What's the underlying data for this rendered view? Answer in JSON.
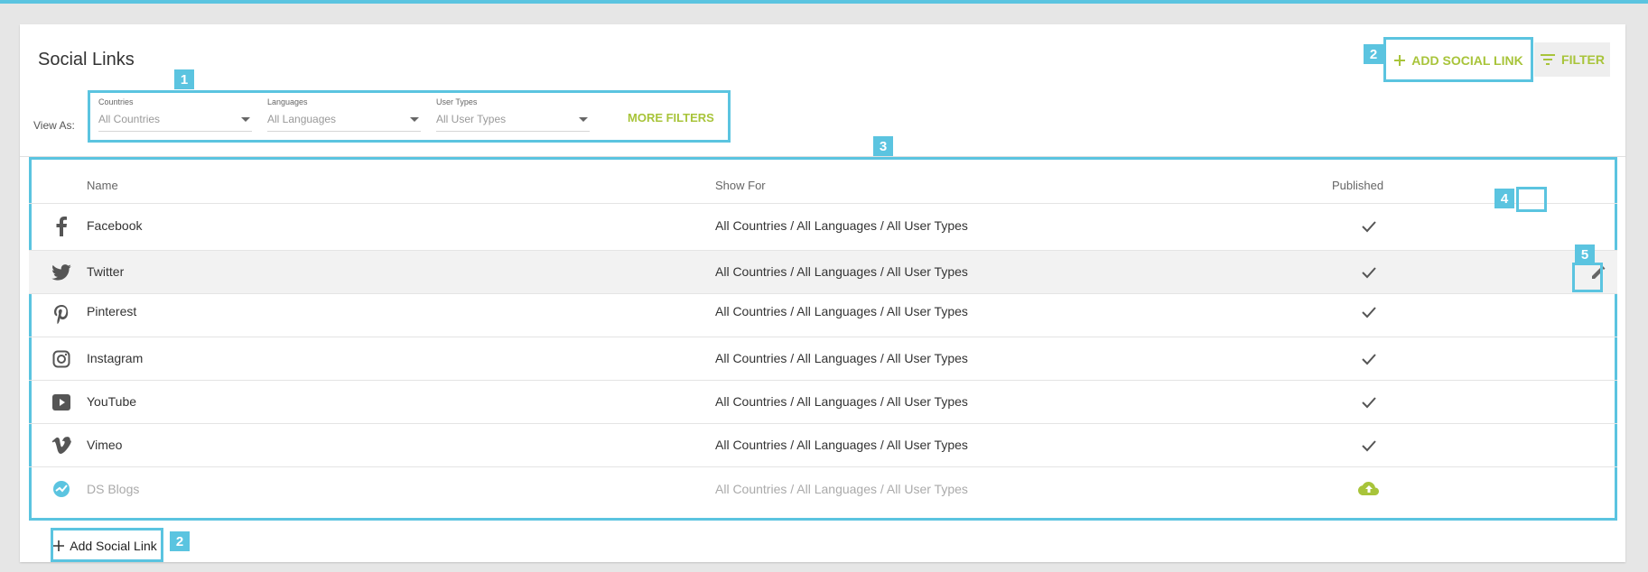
{
  "page_title": "Social Links",
  "header": {
    "add_social_link_label": "ADD SOCIAL LINK",
    "filter_label": "FILTER"
  },
  "filters": {
    "view_as_label": "View As:",
    "countries": {
      "label": "Countries",
      "value": "All Countries"
    },
    "languages": {
      "label": "Languages",
      "value": "All Languages"
    },
    "user_types": {
      "label": "User Types",
      "value": "All User Types"
    },
    "more_filters_label": "MORE FILTERS"
  },
  "table": {
    "columns": [
      "Name",
      "Show For",
      "Published"
    ],
    "rows": [
      {
        "name": "Facebook",
        "show_for": "All Countries / All Languages / All User Types",
        "icon": "facebook-icon",
        "status": "published"
      },
      {
        "name": "Twitter",
        "show_for": "All Countries / All Languages / All User Types",
        "icon": "twitter-icon",
        "status": "published"
      },
      {
        "name": "Pinterest",
        "show_for": "All Countries / All Languages / All User Types",
        "icon": "pinterest-icon",
        "status": "published"
      },
      {
        "name": "Instagram",
        "show_for": "All Countries / All Languages / All User Types",
        "icon": "instagram-icon",
        "status": "published"
      },
      {
        "name": "YouTube",
        "show_for": "All Countries / All Languages / All User Types",
        "icon": "youtube-icon",
        "status": "published"
      },
      {
        "name": "Vimeo",
        "show_for": "All Countries / All Languages / All User Types",
        "icon": "vimeo-icon",
        "status": "published"
      },
      {
        "name": "DS Blogs",
        "show_for": "All Countries / All Languages / All User Types",
        "icon": "ds-blogs-icon",
        "status": "draft"
      }
    ]
  },
  "footer": {
    "add_social_link_label": "Add Social Link"
  },
  "callouts": [
    "1",
    "2",
    "3",
    "4",
    "5",
    "2"
  ],
  "colors": {
    "accent": "#a8c43a",
    "highlight": "#5bc4e0",
    "text": "#333333",
    "muted": "#aaaaaa"
  }
}
